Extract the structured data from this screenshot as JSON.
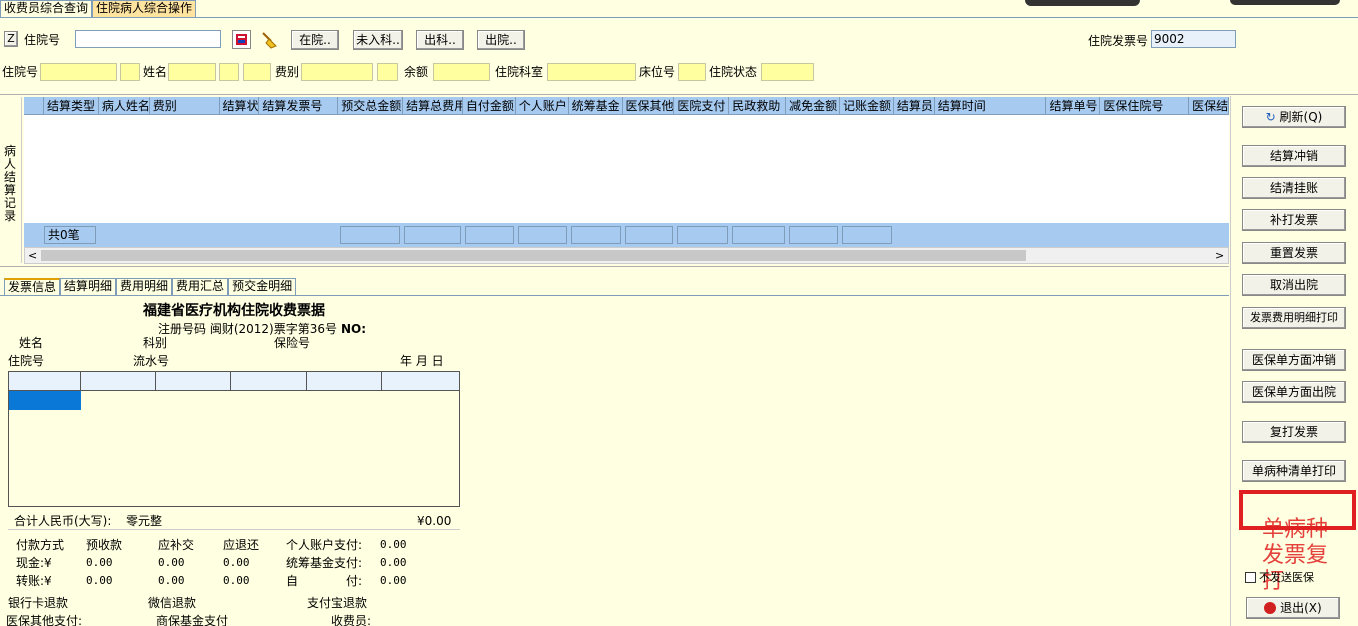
{
  "tabs": [
    "收费员综合查询",
    "住院病人综合操作"
  ],
  "toolbar": {
    "z_button": "Z",
    "zyh_label": "住院号",
    "zyh_value": "",
    "btn_zaiyuan": "在院..",
    "btn_weiruke": "未入科..",
    "btn_chuke": "出科..",
    "btn_chuyuan": "出院..",
    "invoice_label": "住院发票号",
    "invoice_value": "9002"
  },
  "infobar": {
    "zyh": "住院号",
    "name": "姓名",
    "feebie": "费别",
    "balance": "余额",
    "dept": "住院科室",
    "bed": "床位号",
    "status": "住院状态"
  },
  "grid": {
    "side_label": "病人结算记录",
    "columns": [
      "结算类型",
      "病人姓名",
      "费别",
      "结算状",
      "结算发票号",
      "预交总金额",
      "结算总费用",
      "自付金额",
      "个人账户",
      "统筹基金",
      "医保其他",
      "医院支付",
      "民政救助",
      "减免金额",
      "记账金额",
      "结算员",
      "结算时间",
      "结算单号",
      "医保住院号",
      "医保结"
    ],
    "footer_count": "共0笔"
  },
  "bottom_tabs": [
    "发票信息",
    "结算明细",
    "费用明细",
    "费用汇总",
    "预交金明细"
  ],
  "receipt": {
    "title": "福建省医疗机构住院收费票据",
    "reg_code": "注册号码 闽财(2012)票字第36号",
    "no_label": "NO:",
    "name": "姓名",
    "dept": "科别",
    "insurance": "保险号",
    "zyh": "住院号",
    "serial": "流水号",
    "date": "年  月  日",
    "total_label": "合计人民币(大写):",
    "total_cn": "零元整",
    "total_num": "¥0.00",
    "pay_method": "付款方式",
    "prepaid": "预收款",
    "supplement": "应补交",
    "refund": "应退还",
    "personal": "个人账户支付:",
    "personal_v": "0.00",
    "cash": "现金:¥",
    "cash_v1": "0.00",
    "cash_v2": "0.00",
    "cash_v3": "0.00",
    "pool": "统筹基金支付:",
    "pool_v": "0.00",
    "transfer": "转账:¥",
    "tr_v1": "0.00",
    "tr_v2": "0.00",
    "tr_v3": "0.00",
    "self_a": "自",
    "self_b": "付:",
    "self_v": "0.00",
    "bank_refund": "银行卡退款",
    "wechat_refund": "微信退款",
    "alipay_refund": "支付宝退款",
    "med_other": "医保其他支付:",
    "biz_ins": "商保基金支付",
    "cashier": "收费员:"
  },
  "side": {
    "refresh": "刷新(Q)",
    "settle_reverse": "结算冲销",
    "settle_clear": "结清挂账",
    "reprint_invoice": "补打发票",
    "reset_invoice": "重置发票",
    "cancel_discharge": "取消出院",
    "detail_print": "发票费用明细打印",
    "ins_reverse": "医保单方面冲销",
    "ins_discharge": "医保单方面出院",
    "reprint": "复打发票",
    "single_disease_print": "单病种清单打印",
    "annotation": "单病种发票复打",
    "no_send": "不发送医保",
    "exit": "退出(X)"
  },
  "colors": {
    "accent_red": "#E02020",
    "header_blue": "#A6CAF0",
    "bg": "#FFFFE1"
  }
}
